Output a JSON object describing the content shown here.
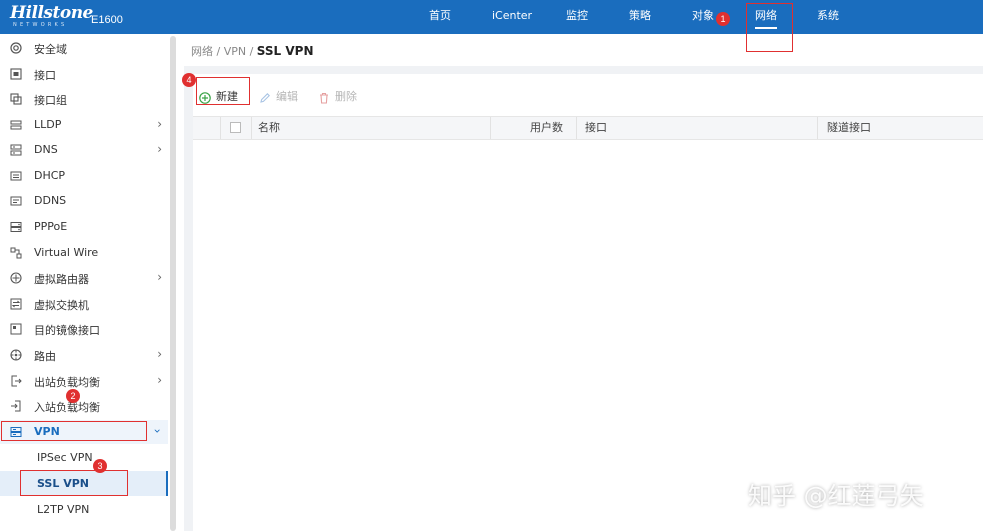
{
  "header": {
    "brand": "Hillstone",
    "brand_sub": "NETWORKS",
    "model": "E1600",
    "nav": [
      {
        "label": "首页"
      },
      {
        "label": "iCenter"
      },
      {
        "label": "监控"
      },
      {
        "label": "策略"
      },
      {
        "label": "对象"
      },
      {
        "label": "网络"
      },
      {
        "label": "系统"
      }
    ],
    "active_nav": "网络"
  },
  "sidebar": {
    "items": [
      {
        "label": "安全域",
        "icon": "shield-zone-icon",
        "has_arrow": false
      },
      {
        "label": "接口",
        "icon": "interface-icon",
        "has_arrow": false
      },
      {
        "label": "接口组",
        "icon": "interface-group-icon",
        "has_arrow": false
      },
      {
        "label": "LLDP",
        "icon": "lldp-icon",
        "has_arrow": true
      },
      {
        "label": "DNS",
        "icon": "dns-icon",
        "has_arrow": true
      },
      {
        "label": "DHCP",
        "icon": "dhcp-icon",
        "has_arrow": false
      },
      {
        "label": "DDNS",
        "icon": "ddns-icon",
        "has_arrow": false
      },
      {
        "label": "PPPoE",
        "icon": "pppoe-icon",
        "has_arrow": false
      },
      {
        "label": "Virtual Wire",
        "icon": "virtual-wire-icon",
        "has_arrow": false
      },
      {
        "label": "虚拟路由器",
        "icon": "virtual-router-icon",
        "has_arrow": true
      },
      {
        "label": "虚拟交换机",
        "icon": "virtual-switch-icon",
        "has_arrow": false
      },
      {
        "label": "目的镜像接口",
        "icon": "mirror-interface-icon",
        "has_arrow": false
      },
      {
        "label": "路由",
        "icon": "route-icon",
        "has_arrow": true
      },
      {
        "label": "出站负载均衡",
        "icon": "outbound-lb-icon",
        "has_arrow": true
      },
      {
        "label": "入站负载均衡",
        "icon": "inbound-lb-icon",
        "has_arrow": false
      },
      {
        "label": "VPN",
        "icon": "vpn-icon",
        "has_arrow": true,
        "expanded": true
      }
    ],
    "vpn_children": [
      {
        "label": "IPSec VPN"
      },
      {
        "label": "SSL VPN",
        "selected": true
      },
      {
        "label": "L2TP VPN"
      }
    ]
  },
  "main": {
    "breadcrumb": {
      "path": "网络 / VPN / ",
      "current": "SSL VPN"
    },
    "toolbar": {
      "new_label": "新建",
      "edit_label": "编辑",
      "delete_label": "删除"
    },
    "table": {
      "columns": [
        "名称",
        "用户数",
        "接口",
        "隧道接口"
      ],
      "rows": []
    }
  },
  "annotations": {
    "badges": [
      "1",
      "2",
      "3",
      "4"
    ]
  },
  "watermark": "知乎 @红莲弓矢",
  "colors": {
    "header_bg": "#1a6dbe",
    "accent": "#1a6dbe",
    "annotation_red": "#e03030",
    "new_icon_green": "#3aa346"
  }
}
